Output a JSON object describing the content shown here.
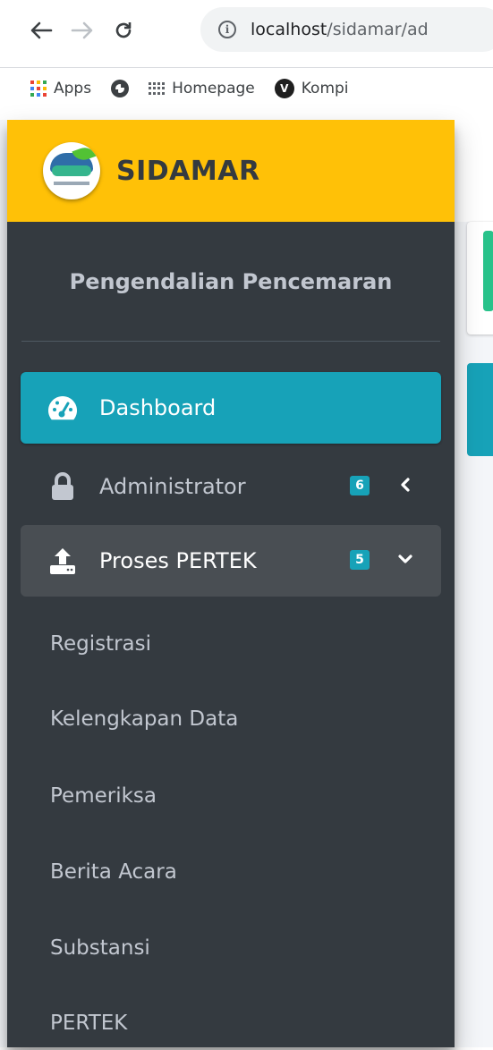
{
  "browser": {
    "url_host": "localhost",
    "url_path": "/sidamar/ad",
    "bookmarks": [
      {
        "label": "Apps",
        "icon": "apps-grid-icon"
      },
      {
        "label": "",
        "icon": "globe-icon"
      },
      {
        "label": "Homepage",
        "icon": "homepage-grid-icon"
      },
      {
        "label": "Kompi",
        "icon": "v-logo-icon"
      }
    ]
  },
  "brand": {
    "name": "SIDAMAR",
    "color": "#ffc107"
  },
  "user_panel": {
    "title": "Pengendalian Pencemaran"
  },
  "nav": {
    "dashboard": {
      "label": "Dashboard",
      "icon": "tachometer-icon",
      "active": true
    },
    "administrator": {
      "label": "Administrator",
      "icon": "lock-icon",
      "badge": "6",
      "chevron": "chevron-left-icon"
    },
    "proses_pertek": {
      "label": "Proses PERTEK",
      "icon": "upload-icon",
      "badge": "5",
      "chevron": "chevron-down-icon",
      "open": true
    },
    "sub_items": [
      {
        "label": "Registrasi"
      },
      {
        "label": "Kelengkapan Data"
      },
      {
        "label": "Pemeriksa"
      },
      {
        "label": "Berita Acara"
      },
      {
        "label": "Substansi"
      },
      {
        "label": "PERTEK"
      }
    ]
  },
  "colors": {
    "sidebar_bg": "#343a40",
    "active_bg": "#17a2b8",
    "badge_bg": "#17a2b8",
    "open_bg": "#494e53",
    "text": "#c2c7d0"
  }
}
